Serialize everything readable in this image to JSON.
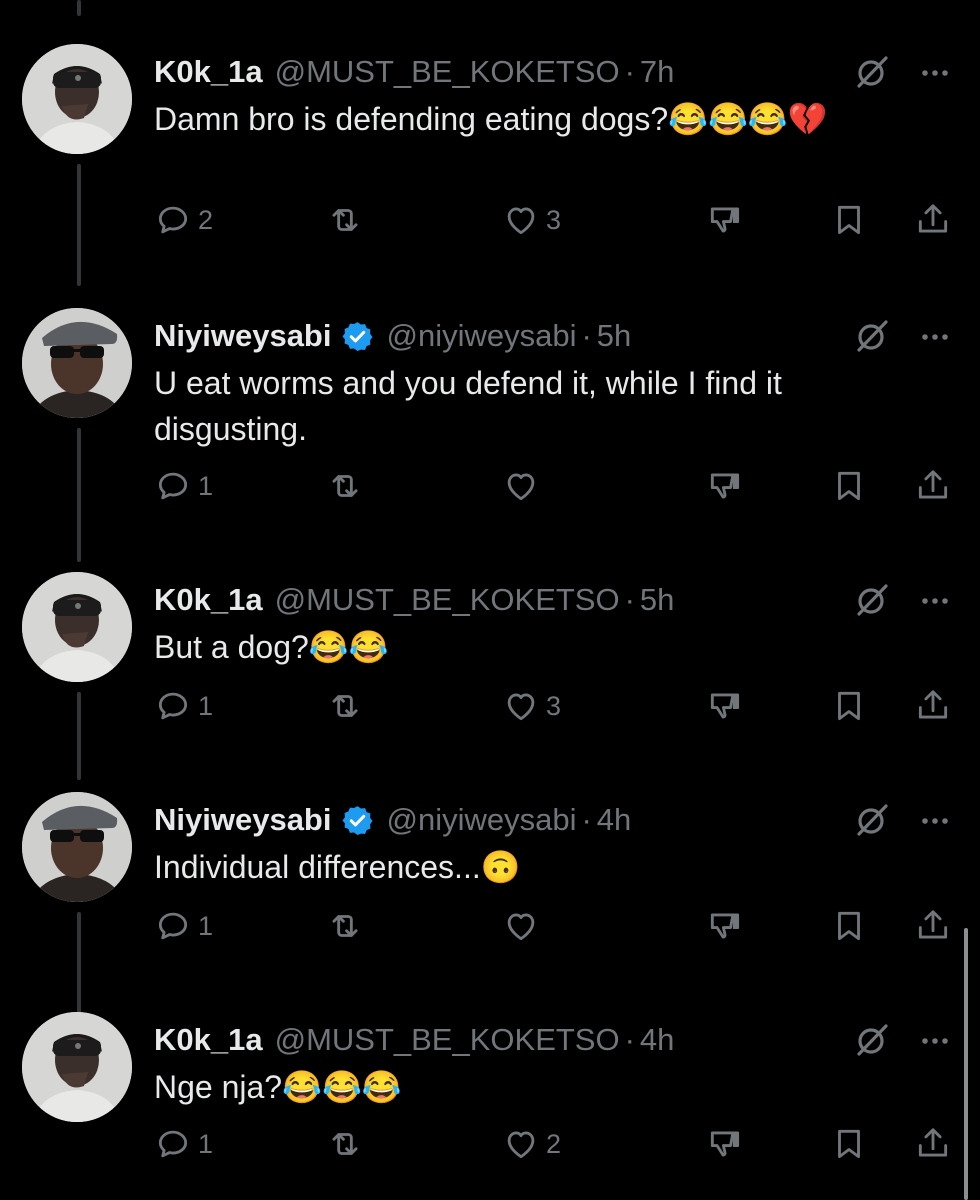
{
  "tweets": [
    {
      "name": "K0k_1a",
      "handle": "@MUST_BE_KOKETSO",
      "separator": "·",
      "time": "7h",
      "verified": false,
      "text": "Damn bro is defending eating dogs?😂😂😂💔",
      "replies": "2",
      "retweets": "",
      "likes": "3"
    },
    {
      "name": "Niyiweysabi",
      "handle": "@niyiweysabi",
      "separator": "·",
      "time": "5h",
      "verified": true,
      "text": "U eat worms and you defend it, while I find it disgusting.",
      "replies": "1",
      "retweets": "",
      "likes": ""
    },
    {
      "name": "K0k_1a",
      "handle": "@MUST_BE_KOKETSO",
      "separator": "·",
      "time": "5h",
      "verified": false,
      "text": "But a dog?😂😂",
      "replies": "1",
      "retweets": "",
      "likes": "3"
    },
    {
      "name": "Niyiweysabi",
      "handle": "@niyiweysabi",
      "separator": "·",
      "time": "4h",
      "verified": true,
      "text": "Individual differences...🙃",
      "replies": "1",
      "retweets": "",
      "likes": ""
    },
    {
      "name": "K0k_1a",
      "handle": "@MUST_BE_KOKETSO",
      "separator": "·",
      "time": "4h",
      "verified": false,
      "text": "Nge nja?😂😂😂",
      "replies": "1",
      "retweets": "",
      "likes": "2"
    }
  ],
  "icons": {
    "reply": "reply-icon",
    "retweet": "retweet-icon",
    "like": "heart-icon",
    "dislike": "dislike-icon",
    "bookmark": "bookmark-icon",
    "share": "share-icon",
    "grok": "grok-icon",
    "more": "more-icon",
    "verified": "verified-badge-icon"
  },
  "colors": {
    "background": "#000000",
    "text": "#e7e9ea",
    "muted": "#71767b",
    "verified": "#1d9bf0",
    "thread_line": "#333639"
  }
}
